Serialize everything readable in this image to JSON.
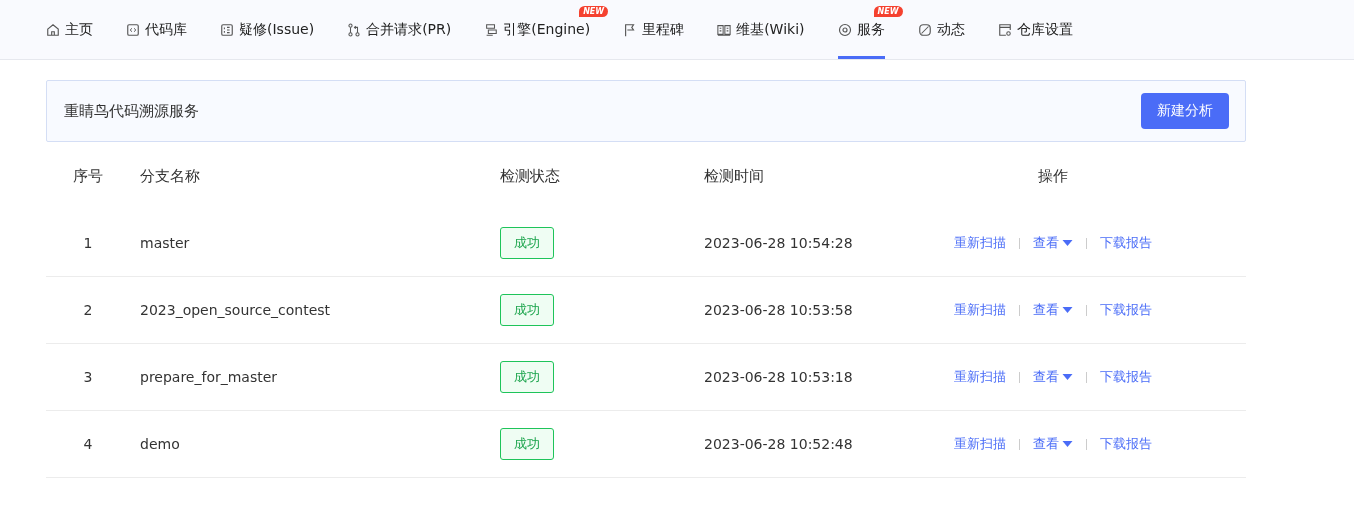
{
  "tabs": [
    {
      "label": "主页",
      "selected": false
    },
    {
      "label": "代码库",
      "selected": false
    },
    {
      "label": "疑修(Issue)",
      "selected": false
    },
    {
      "label": "合并请求(PR)",
      "selected": false
    },
    {
      "label": "引擎(Engine)",
      "selected": false,
      "badge": "NEW"
    },
    {
      "label": "里程碑",
      "selected": false
    },
    {
      "label": "维基(Wiki)",
      "selected": false
    },
    {
      "label": "服务",
      "selected": true,
      "badge": "NEW"
    },
    {
      "label": "动态",
      "selected": false
    },
    {
      "label": "仓库设置",
      "selected": false
    }
  ],
  "panel": {
    "title": "重睛鸟代码溯源服务",
    "button": "新建分析"
  },
  "table": {
    "columns": [
      "序号",
      "分支名称",
      "检测状态",
      "检测时间",
      "操作"
    ],
    "rows": [
      {
        "index": "1",
        "branch": "master",
        "status": "成功",
        "time": "2023-06-28 10:54:28",
        "actions": [
          "重新扫描",
          "查看",
          "下载报告"
        ]
      },
      {
        "index": "2",
        "branch": "2023_open_source_contest",
        "status": "成功",
        "time": "2023-06-28 10:53:58",
        "actions": [
          "重新扫描",
          "查看",
          "下载报告"
        ]
      },
      {
        "index": "3",
        "branch": "prepare_for_master",
        "status": "成功",
        "time": "2023-06-28 10:53:18",
        "actions": [
          "重新扫描",
          "查看",
          "下载报告"
        ]
      },
      {
        "index": "4",
        "branch": "demo",
        "status": "成功",
        "time": "2023-06-28 10:52:48",
        "actions": [
          "重新扫描",
          "查看",
          "下载报告"
        ]
      }
    ]
  }
}
